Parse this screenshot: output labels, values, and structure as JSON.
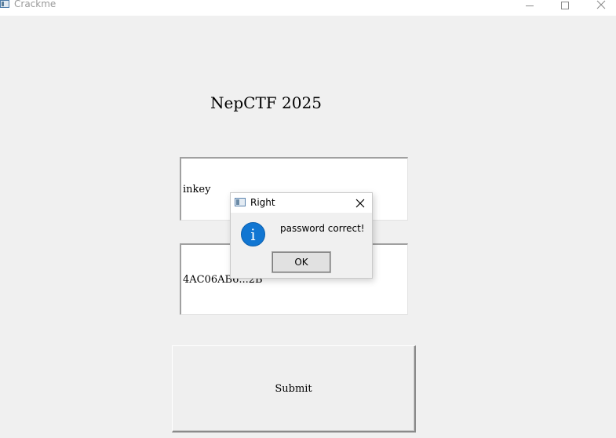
{
  "window": {
    "title": "Crackme",
    "icon": "app-window-icon",
    "controls": [
      "minimize",
      "maximize",
      "close"
    ]
  },
  "main": {
    "heading": "NepCTF 2025",
    "username_value": "inkey",
    "key_value_visible": "4AC06AB6...2B",
    "submit_label": "Submit"
  },
  "dialog": {
    "title": "Right",
    "message": "password correct!",
    "icon": "info-icon",
    "ok_label": "OK",
    "accent_color": "#1176d2"
  }
}
